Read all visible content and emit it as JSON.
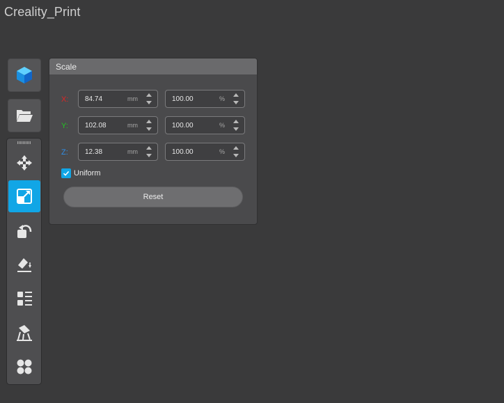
{
  "app": {
    "title": "Creality_Print"
  },
  "toolbar": {
    "top_buttons": [
      {
        "name": "cube-icon"
      },
      {
        "name": "folder-open-icon"
      }
    ],
    "tools": [
      {
        "name": "move-icon",
        "active": false
      },
      {
        "name": "scale-icon",
        "active": true
      },
      {
        "name": "rotate-icon",
        "active": false
      },
      {
        "name": "lay-flat-icon",
        "active": false
      },
      {
        "name": "list-icon",
        "active": false
      },
      {
        "name": "support-icon",
        "active": false
      },
      {
        "name": "apps-icon",
        "active": false
      }
    ]
  },
  "scale_panel": {
    "title": "Scale",
    "rows": [
      {
        "axis": "X:",
        "color": "#e02525",
        "value": "84.74",
        "unit": "mm",
        "percent": "100.00",
        "percent_unit": "%"
      },
      {
        "axis": "Y:",
        "color": "#22c322",
        "value": "102.08",
        "unit": "mm",
        "percent": "100.00",
        "percent_unit": "%"
      },
      {
        "axis": "Z:",
        "color": "#2f8fe8",
        "value": "12.38",
        "unit": "mm",
        "percent": "100.00",
        "percent_unit": "%"
      }
    ],
    "uniform_label": "Uniform",
    "uniform_checked": true,
    "reset_label": "Reset"
  },
  "colors": {
    "accent": "#11a6e6"
  }
}
